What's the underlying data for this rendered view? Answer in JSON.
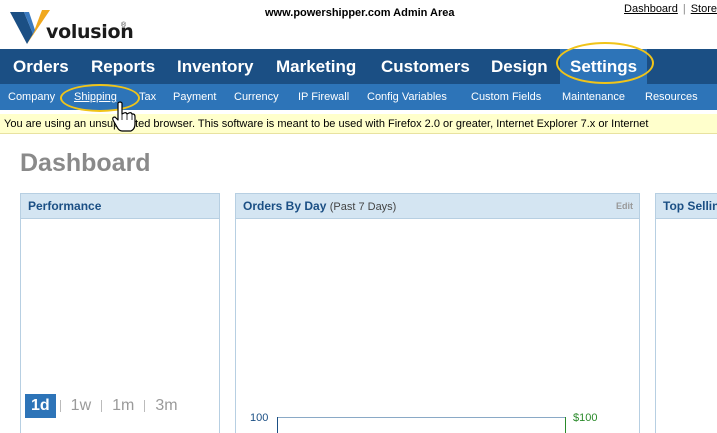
{
  "header": {
    "logo_text": "volusion",
    "logo_reg": "®",
    "admin_area": "www.powershipper.com Admin Area",
    "links": [
      "Dashboard",
      "Store"
    ],
    "link_separator": "|"
  },
  "main_nav": {
    "items": [
      "Orders",
      "Reports",
      "Inventory",
      "Marketing",
      "Customers",
      "Design",
      "Settings"
    ],
    "active": "Settings"
  },
  "sub_nav": {
    "items": [
      "Company",
      "Shipping",
      "Tax",
      "Payment",
      "Currency",
      "IP Firewall",
      "Config Variables",
      "Custom Fields",
      "Maintenance",
      "Resources"
    ],
    "current": "Shipping"
  },
  "warning": "You are using an unsupported browser. This software is meant to be used with Firefox 2.0 or greater, Internet Explorer 7.x or Internet",
  "page_title": "Dashboard",
  "panels": {
    "performance": {
      "title": "Performance",
      "ranges": [
        "1d",
        "1w",
        "1m",
        "3m"
      ],
      "active_range": "1d"
    },
    "orders_by_day": {
      "title": "Orders By Day",
      "subtitle": "(Past 7 Days)",
      "edit_label": "Edit",
      "left_axis_top": "100",
      "right_axis_top": "$100"
    },
    "top_selling": {
      "title": "Top Selling"
    }
  },
  "colors": {
    "nav_dark": "#1b4f84",
    "nav_light": "#2d74b8",
    "highlight_ring": "#f0c419",
    "warning_bg": "#ffffcc",
    "panel_head": "#d4e5f2"
  },
  "icons": {
    "logo": "volusion-v-logo-icon",
    "pointer": "hand-pointer-icon"
  }
}
